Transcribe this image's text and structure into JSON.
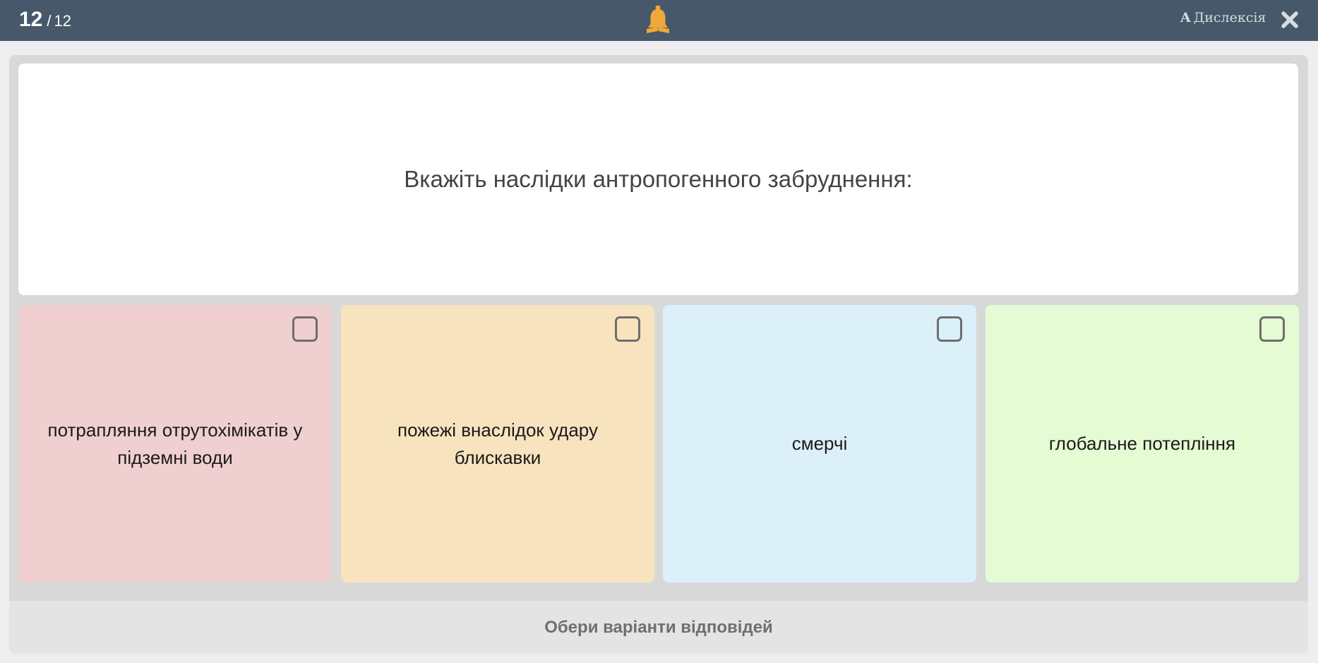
{
  "header": {
    "current_question": "12",
    "separator": "/",
    "total_questions": "12",
    "dyslexia_mark": "A",
    "dyslexia_label": "Дислексія",
    "bell_icon": "bell-book-icon",
    "close_icon": "close-icon",
    "bar_color": "#465869",
    "accent_color": "#f0a83a"
  },
  "question": {
    "text": "Вкажіть наслідки антропогенного забруднення:"
  },
  "answers": [
    {
      "text": "потрапляння отрутохімікатів у підземні води",
      "color": "#f0cfd0",
      "checked": false
    },
    {
      "text": "пожежі внаслідок удару блискавки",
      "color": "#f8e3bf",
      "checked": false
    },
    {
      "text": "смерчі",
      "color": "#dcf0f9",
      "checked": false
    },
    {
      "text": "глобальне потепління",
      "color": "#e4fbd3",
      "checked": false
    }
  ],
  "footer": {
    "prompt": "Обери варіанти відповідей"
  }
}
